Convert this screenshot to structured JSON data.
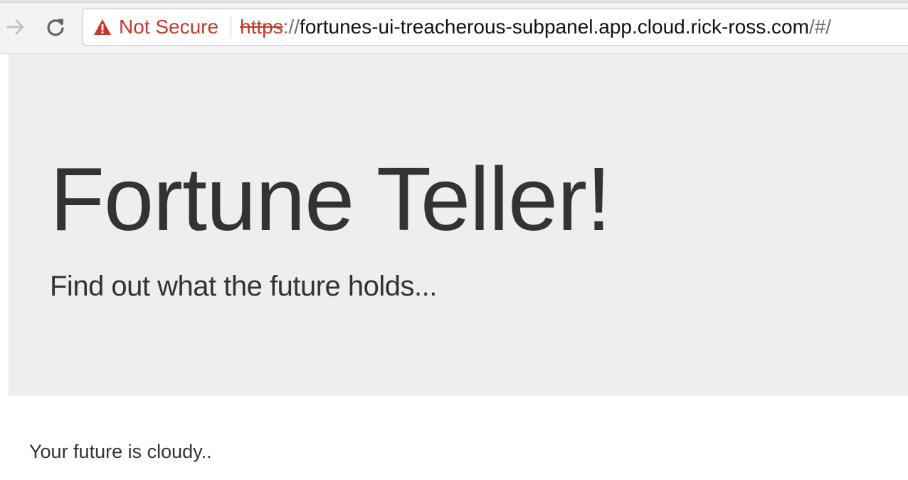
{
  "browser": {
    "security_label": "Not Secure",
    "url": {
      "scheme": "https",
      "separator": "://",
      "host": "fortunes-ui-treacherous-subpanel.app.cloud.rick-ross.com",
      "path": "/#/"
    },
    "icons": {
      "forward": "arrow-right-icon",
      "reload": "reload-icon",
      "security": "warning-triangle-icon"
    },
    "colors": {
      "insecure_red": "#c5392b",
      "toolbar_bg": "#f3f3f3"
    }
  },
  "page": {
    "title": "Fortune Teller!",
    "subtitle": "Find out what the future holds...",
    "fortune": "Your future is cloudy..",
    "colors": {
      "jumbotron_bg": "#eeeeee",
      "text": "#333333"
    }
  }
}
